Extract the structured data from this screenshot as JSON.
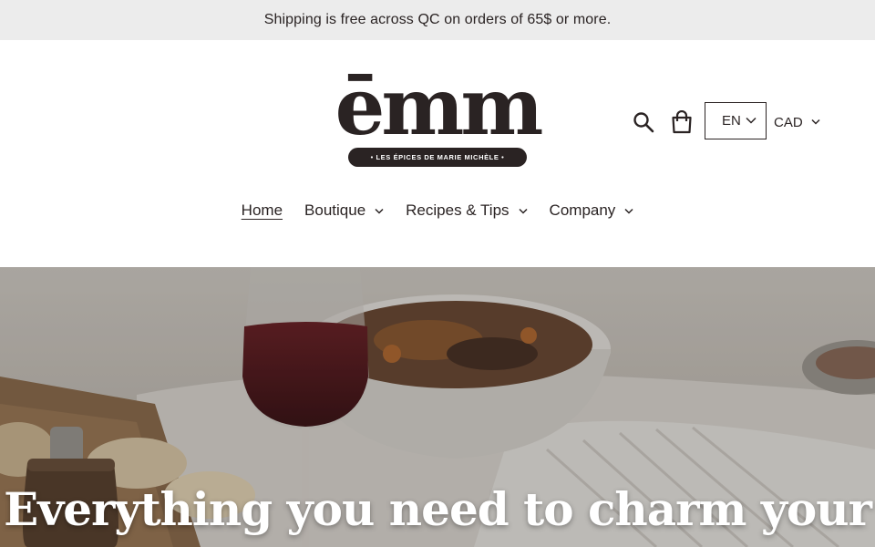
{
  "announcement": {
    "text": "Shipping is free across QC on orders of 65$ or more."
  },
  "logo": {
    "word": "ēmm",
    "tagline": "• LES ÉPICES DE MARIE MICHÈLE •"
  },
  "header": {
    "search_icon": "search-icon",
    "cart_icon": "shopping-bag-icon",
    "language": "EN",
    "currency": "CAD"
  },
  "nav": {
    "items": [
      {
        "label": "Home",
        "active": true,
        "dropdown": false
      },
      {
        "label": "Boutique",
        "active": false,
        "dropdown": true
      },
      {
        "label": "Recipes & Tips",
        "active": false,
        "dropdown": true
      },
      {
        "label": "Company",
        "active": false,
        "dropdown": true
      }
    ]
  },
  "hero": {
    "title": "Everything you need to charm your"
  },
  "colors": {
    "text": "#2a2323",
    "announcement_bg": "#ececec",
    "hero_text": "#ffffff"
  }
}
